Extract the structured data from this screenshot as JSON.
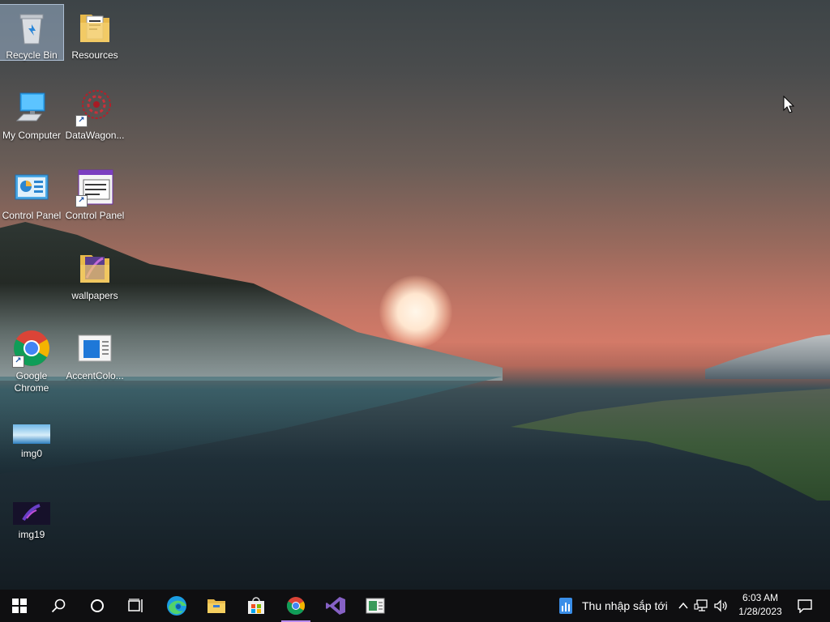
{
  "desktop": {
    "icons": [
      {
        "label": "Recycle Bin"
      },
      {
        "label": "Resources"
      },
      {
        "label": "My Computer"
      },
      {
        "label": "DataWagon..."
      },
      {
        "label": "Control Panel"
      },
      {
        "label": "Control Panel"
      },
      {
        "label": "wallpapers"
      },
      {
        "label": "Google Chrome"
      },
      {
        "label": "AccentColo..."
      },
      {
        "label": "img0"
      },
      {
        "label": "img19"
      }
    ]
  },
  "taskbar": {
    "pinned": [
      "start-icon",
      "search-icon",
      "cortana-icon",
      "task-view-icon",
      "edge-icon",
      "file-explorer-icon",
      "store-icon",
      "chrome-icon",
      "visual-studio-icon",
      "accent-color-app-icon"
    ],
    "weather_text": "Thu nhập sắp tới",
    "clock_time": "6:03 AM",
    "clock_date": "1/28/2023",
    "active_color": "#b98cf0"
  }
}
